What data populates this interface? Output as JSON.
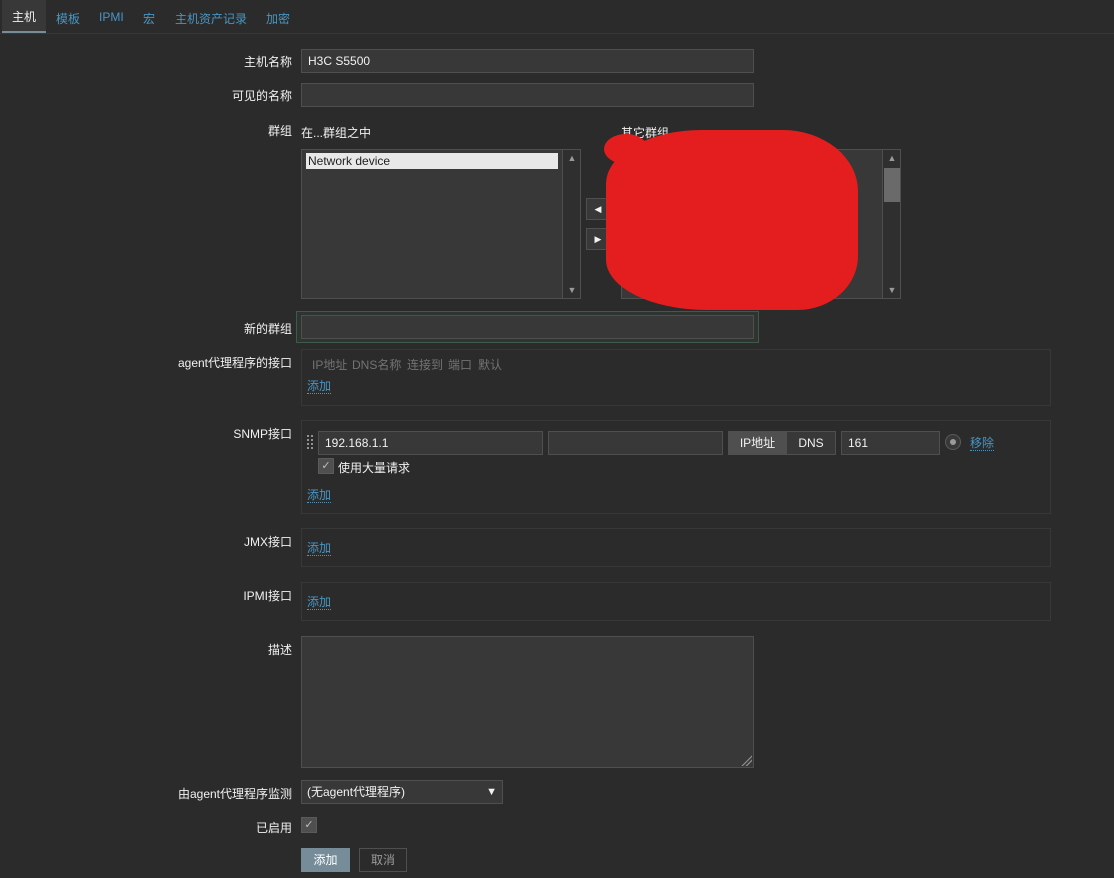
{
  "tabs": [
    {
      "label": "主机"
    },
    {
      "label": "模板"
    },
    {
      "label": "IPMI"
    },
    {
      "label": "宏"
    },
    {
      "label": "主机资产记录"
    },
    {
      "label": "加密"
    }
  ],
  "form": {
    "host_name": {
      "label": "主机名称",
      "value": "H3C S5500"
    },
    "visible_name": {
      "label": "可见的名称",
      "value": ""
    },
    "groups": {
      "label": "群组",
      "in_groups_label": "在...群组之中",
      "other_groups_label": "其它群组",
      "in_groups_items": [
        "Network device"
      ]
    },
    "new_group": {
      "label": "新的群组",
      "value": ""
    },
    "agent_interfaces": {
      "label": "agent代理程序的接口",
      "headers": [
        "IP地址",
        "DNS名称",
        "连接到",
        "端口",
        "默认"
      ],
      "add_label": "添加"
    },
    "snmp_interfaces": {
      "label": "SNMP接口",
      "ip": "192.168.1.1",
      "dns": "",
      "connect_ip": "IP地址",
      "connect_dns": "DNS",
      "port": "161",
      "remove_label": "移除",
      "bulk_label": "使用大量请求",
      "add_label": "添加"
    },
    "jmx_interfaces": {
      "label": "JMX接口",
      "add_label": "添加"
    },
    "ipmi_interfaces": {
      "label": "IPMI接口",
      "add_label": "添加"
    },
    "description": {
      "label": "描述",
      "value": ""
    },
    "monitored_by_proxy": {
      "label": "由agent代理程序监测",
      "selected": "(无agent代理程序)"
    },
    "enabled": {
      "label": "已启用"
    },
    "buttons": {
      "add": "添加",
      "cancel": "取消"
    }
  },
  "colors": {
    "background": "#2b2b2b",
    "link": "#4796c4",
    "redaction": "#e41e1e",
    "primary_button": "#768d99"
  }
}
